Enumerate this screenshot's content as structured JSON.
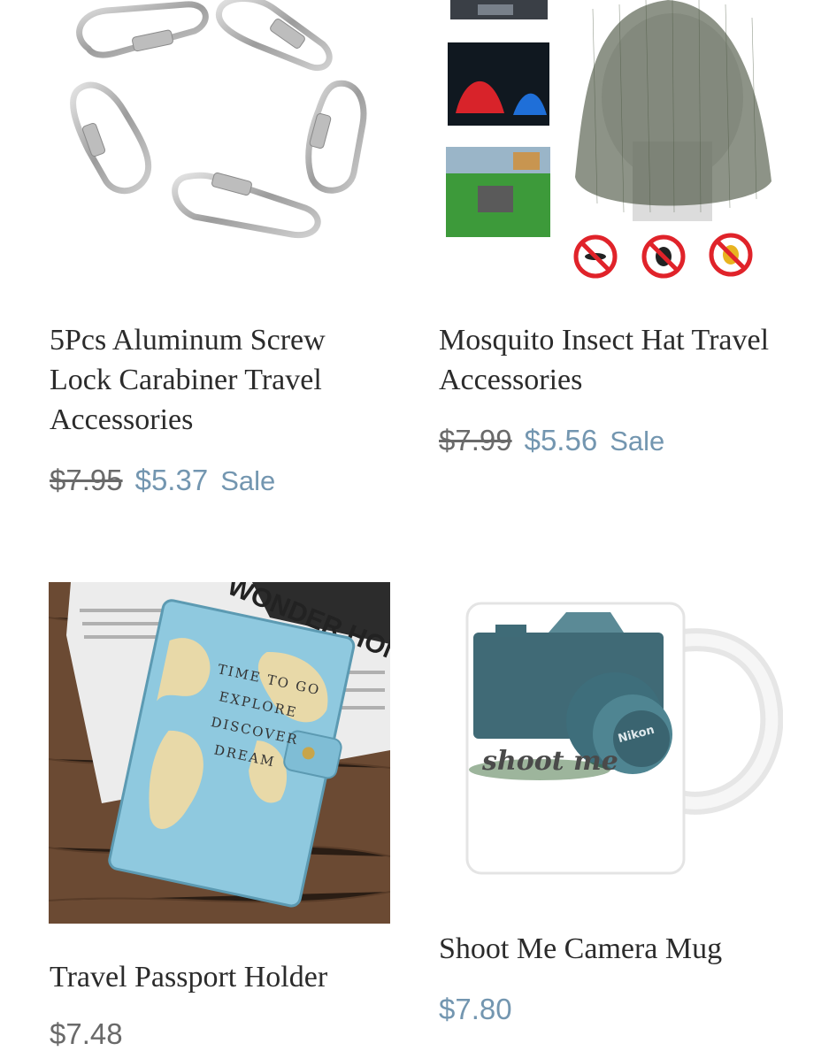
{
  "products": [
    {
      "title": "5Pcs Aluminum Screw Lock Carabiner Travel Accessories",
      "old_price": "$7.95",
      "price": "$5.37",
      "sale_label": "Sale"
    },
    {
      "title": "Mosquito Insect Hat Travel Accessories",
      "old_price": "$7.99",
      "price": "$5.56",
      "sale_label": "Sale"
    },
    {
      "title": "Travel Passport Holder",
      "price": "$7.48",
      "passport_text": [
        "TIME TO GO",
        "EXPLORE",
        "DISCOVER",
        "DREAM"
      ],
      "magazine_text": "WONDER HOME"
    },
    {
      "title": "Shoot Me Camera Mug",
      "price": "$7.80",
      "mug_text": "shoot me",
      "camera_brand": "Nikon"
    }
  ],
  "colors": {
    "sale": "#7396b0",
    "old_price": "#6a6a6a",
    "title": "#2b2b2b"
  }
}
